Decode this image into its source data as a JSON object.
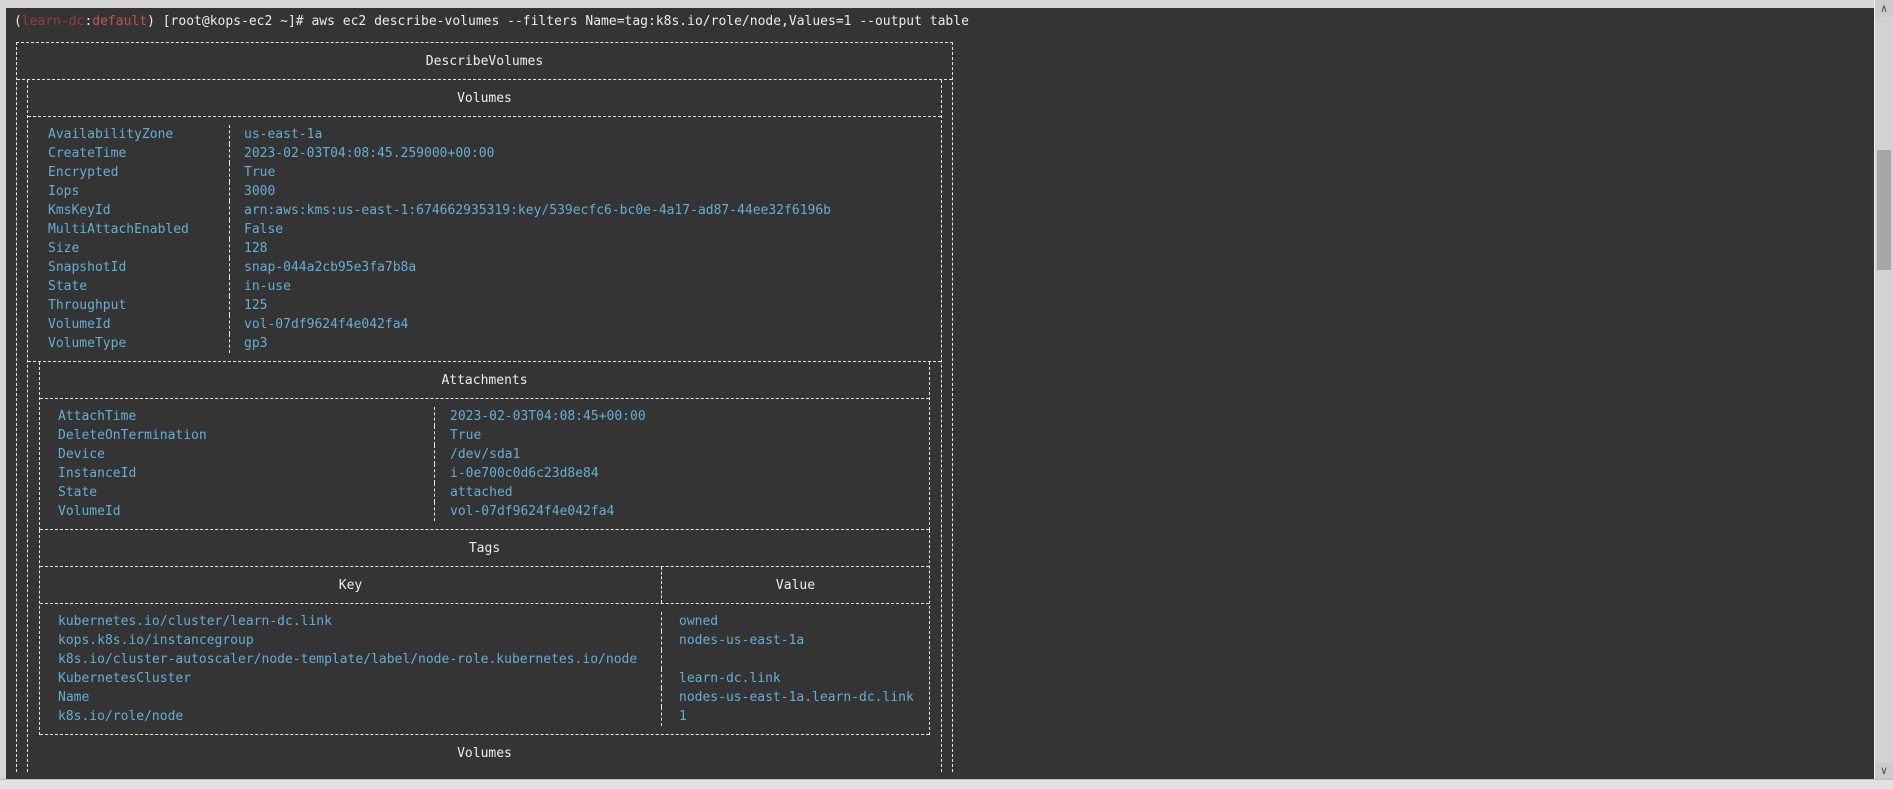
{
  "colors": {
    "terminal_background": "#343434",
    "frame_background": "#d6d6d6",
    "default_text": "#ececec",
    "data_text": "#64aed6",
    "prompt_context_color": "#9b3c3c",
    "prompt_namespace_color": "#c94f4f",
    "table_border": "#e6e6e6"
  },
  "terminal": {
    "prompt": {
      "open_paren": "(",
      "context": "learn-dc",
      "separator": ":",
      "namespace": "default",
      "close_paren": ") ",
      "user_host": "[root@kops-ec2 ~]# ",
      "command": "aws ec2 describe-volumes --filters Name=tag:k8s.io/role/node,Values=1 --output table"
    },
    "output": {
      "title": "DescribeVolumes",
      "volumes": {
        "title": "Volumes",
        "fields": [
          {
            "key": "AvailabilityZone",
            "value": "us-east-1a"
          },
          {
            "key": "CreateTime",
            "value": "2023-02-03T04:08:45.259000+00:00"
          },
          {
            "key": "Encrypted",
            "value": "True"
          },
          {
            "key": "Iops",
            "value": "3000"
          },
          {
            "key": "KmsKeyId",
            "value": "arn:aws:kms:us-east-1:674662935319:key/539ecfc6-bc0e-4a17-ad87-44ee32f6196b"
          },
          {
            "key": "MultiAttachEnabled",
            "value": "False"
          },
          {
            "key": "Size",
            "value": "128"
          },
          {
            "key": "SnapshotId",
            "value": "snap-044a2cb95e3fa7b8a"
          },
          {
            "key": "State",
            "value": "in-use"
          },
          {
            "key": "Throughput",
            "value": "125"
          },
          {
            "key": "VolumeId",
            "value": "vol-07df9624f4e042fa4"
          },
          {
            "key": "VolumeType",
            "value": "gp3"
          }
        ]
      },
      "attachments": {
        "title": "Attachments",
        "fields": [
          {
            "key": "AttachTime",
            "value": "2023-02-03T04:08:45+00:00"
          },
          {
            "key": "DeleteOnTermination",
            "value": "True"
          },
          {
            "key": "Device",
            "value": "/dev/sda1"
          },
          {
            "key": "InstanceId",
            "value": "i-0e700c0d6c23d8e84"
          },
          {
            "key": "State",
            "value": "attached"
          },
          {
            "key": "VolumeId",
            "value": "vol-07df9624f4e042fa4"
          }
        ]
      },
      "tags": {
        "title": "Tags",
        "key_header": "Key",
        "value_header": "Value",
        "rows": [
          {
            "key": "kubernetes.io/cluster/learn-dc.link",
            "value": "owned"
          },
          {
            "key": "kops.k8s.io/instancegroup",
            "value": "nodes-us-east-1a"
          },
          {
            "key": "k8s.io/cluster-autoscaler/node-template/label/node-role.kubernetes.io/node",
            "value": ""
          },
          {
            "key": "KubernetesCluster",
            "value": "learn-dc.link"
          },
          {
            "key": "Name",
            "value": "nodes-us-east-1a.learn-dc.link"
          },
          {
            "key": "k8s.io/role/node",
            "value": "1"
          }
        ]
      },
      "next_record_title": "Volumes"
    }
  },
  "scrollbar": {
    "up_arrow": "∧",
    "down_arrow": "∨"
  }
}
